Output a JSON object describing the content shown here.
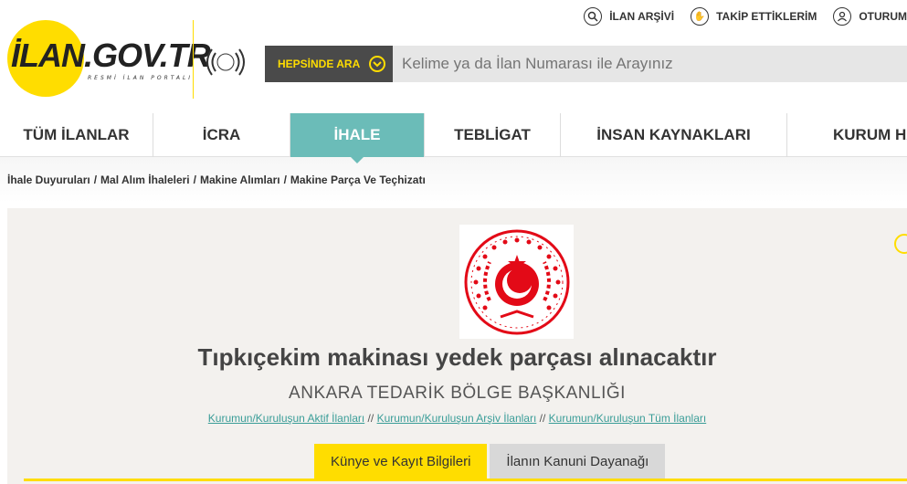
{
  "logo": {
    "text": "İLAN.GOV.TR",
    "subtitle": "RESMİ İLAN PORTALI"
  },
  "top_links": [
    {
      "label": "İLAN ARŞİVİ",
      "icon": "archive-search-icon"
    },
    {
      "label": "TAKİP ETTİKLERİM",
      "icon": "follow-hand-icon"
    },
    {
      "label": "OTURUM",
      "icon": "user-icon"
    }
  ],
  "search": {
    "category": "HEPSİNDE ARA",
    "placeholder": "Kelime ya da İlan Numarası ile Arayınız"
  },
  "nav": [
    {
      "label": "TÜM İLANLAR",
      "active": false
    },
    {
      "label": "İCRA",
      "active": false
    },
    {
      "label": "İHALE",
      "active": true
    },
    {
      "label": "TEBLİGAT",
      "active": false
    },
    {
      "label": "İNSAN KAYNAKLARI",
      "active": false
    },
    {
      "label": "KURUM HA",
      "active": false
    }
  ],
  "breadcrumb": [
    "İhale Duyuruları",
    "Mal Alım İhaleleri",
    "Makine Alımları",
    "Makine Parça Ve Teçhizatı"
  ],
  "listing": {
    "title": "Tıpkıçekim makinası yedek parçası alınacaktır",
    "organization": "ANKARA TEDARİK BÖLGE BAŞKANLIĞI",
    "links": [
      "Kurumun/Kuruluşun Aktif İlanları",
      "Kurumun/Kuruluşun Arşiv İlanları",
      "Kurumun/Kuruluşun Tüm İlanları"
    ],
    "link_separator": "//"
  },
  "tabs": [
    {
      "label": "Künye ve Kayıt Bilgileri",
      "active": true
    },
    {
      "label": "İlanın Kanuni Dayanağı",
      "active": false
    }
  ],
  "colors": {
    "accent_yellow": "#ffdd00",
    "teal": "#6bbcb8",
    "emblem_red": "#e30a17"
  }
}
